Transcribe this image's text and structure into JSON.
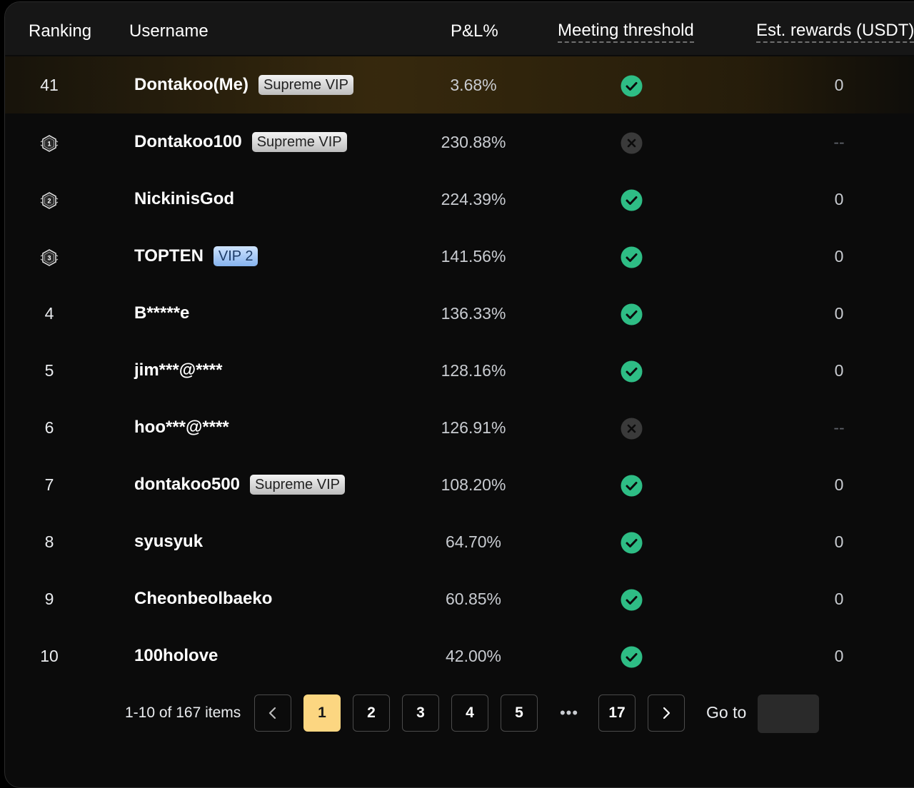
{
  "table": {
    "headers": {
      "ranking": "Ranking",
      "username": "Username",
      "pnl": "P&L%",
      "meeting": "Meeting threshold",
      "rewards": "Est. rewards (USDT)"
    },
    "rows": [
      {
        "rank": "41",
        "rank_icon": "",
        "username": "Dontakoo(Me)",
        "badge": "Supreme VIP",
        "badge_type": "supreme",
        "pnl": "3.68%",
        "meeting": "check",
        "reward": "0",
        "is_me": true
      },
      {
        "rank": "",
        "rank_icon": "rank-1-medal-icon",
        "username": "Dontakoo100",
        "badge": "Supreme VIP",
        "badge_type": "supreme",
        "pnl": "230.88%",
        "meeting": "cross",
        "reward": "--",
        "is_me": false
      },
      {
        "rank": "",
        "rank_icon": "rank-2-medal-icon",
        "username": "NickinisGod",
        "badge": "",
        "badge_type": "",
        "pnl": "224.39%",
        "meeting": "check",
        "reward": "0",
        "is_me": false
      },
      {
        "rank": "",
        "rank_icon": "rank-3-medal-icon",
        "username": "TOPTEN",
        "badge": "VIP 2",
        "badge_type": "vip",
        "pnl": "141.56%",
        "meeting": "check",
        "reward": "0",
        "is_me": false
      },
      {
        "rank": "4",
        "rank_icon": "",
        "username": "B*****e",
        "badge": "",
        "badge_type": "",
        "pnl": "136.33%",
        "meeting": "check",
        "reward": "0",
        "is_me": false
      },
      {
        "rank": "5",
        "rank_icon": "",
        "username": "jim***@****",
        "badge": "",
        "badge_type": "",
        "pnl": "128.16%",
        "meeting": "check",
        "reward": "0",
        "is_me": false
      },
      {
        "rank": "6",
        "rank_icon": "",
        "username": "hoo***@****",
        "badge": "",
        "badge_type": "",
        "pnl": "126.91%",
        "meeting": "cross",
        "reward": "--",
        "is_me": false
      },
      {
        "rank": "7",
        "rank_icon": "",
        "username": "dontakoo500",
        "badge": "Supreme VIP",
        "badge_type": "supreme",
        "pnl": "108.20%",
        "meeting": "check",
        "reward": "0",
        "is_me": false
      },
      {
        "rank": "8",
        "rank_icon": "",
        "username": "syusyuk",
        "badge": "",
        "badge_type": "",
        "pnl": "64.70%",
        "meeting": "check",
        "reward": "0",
        "is_me": false
      },
      {
        "rank": "9",
        "rank_icon": "",
        "username": "Cheonbeolbaeko",
        "badge": "",
        "badge_type": "",
        "pnl": "60.85%",
        "meeting": "check",
        "reward": "0",
        "is_me": false
      },
      {
        "rank": "10",
        "rank_icon": "",
        "username": "100holove",
        "badge": "",
        "badge_type": "",
        "pnl": "42.00%",
        "meeting": "check",
        "reward": "0",
        "is_me": false
      }
    ]
  },
  "pagination": {
    "summary": "1-10 of 167 items",
    "prev_icon": "chevron-left-icon",
    "next_icon": "chevron-right-icon",
    "pages": [
      "1",
      "2",
      "3",
      "4",
      "5"
    ],
    "active_page": "1",
    "ellipsis": "•••",
    "last_page": "17",
    "goto_label": "Go to",
    "goto_value": ""
  },
  "colors": {
    "check": "#2ebd85",
    "cross": "#3a3a3a",
    "active_page": "#fcd681"
  }
}
